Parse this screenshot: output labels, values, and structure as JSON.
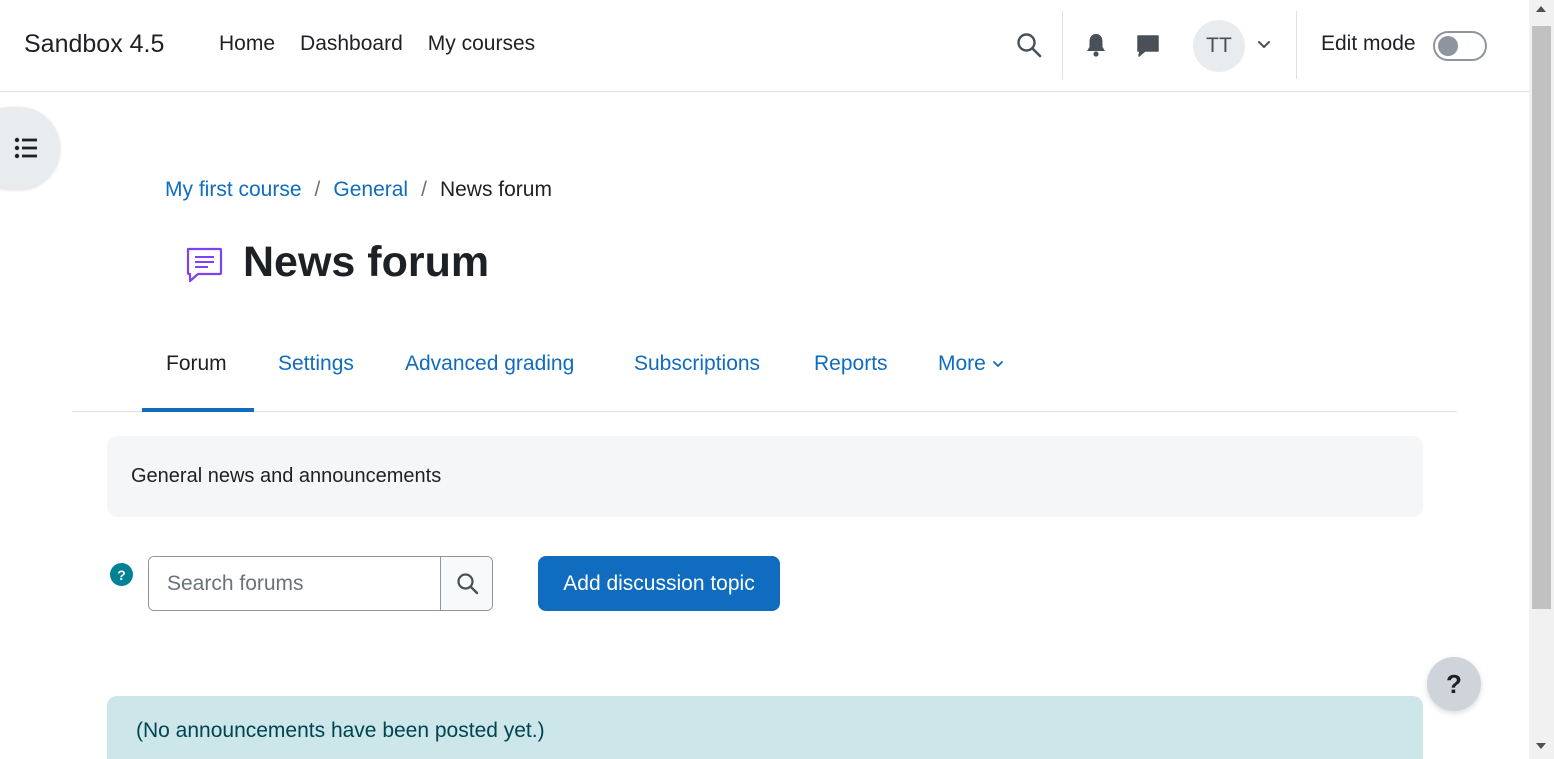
{
  "navbar": {
    "brand": "Sandbox 4.5",
    "links": [
      "Home",
      "Dashboard",
      "My courses"
    ],
    "search_icon": "search-icon",
    "notifications_icon": "bell-icon",
    "messages_icon": "chat-bubble-icon",
    "avatar_initials": "TT",
    "user_menu_icon": "chevron-down-icon",
    "edit_mode_label": "Edit mode",
    "edit_mode_on": false
  },
  "drawer": {
    "icon": "list-icon"
  },
  "breadcrumb": {
    "items": [
      "My first course",
      "General"
    ],
    "separator": "/",
    "current": "News forum"
  },
  "page": {
    "title": "News forum",
    "icon": "forum-icon"
  },
  "tabs": {
    "items": [
      "Forum",
      "Settings",
      "Advanced grading",
      "Subscriptions",
      "Reports",
      "More"
    ],
    "active": "Forum"
  },
  "intro": {
    "text": "General news and announcements"
  },
  "search": {
    "placeholder": "Search forums",
    "help_symbol": "?",
    "submit_icon": "search-icon"
  },
  "actions": {
    "add_discussion": "Add discussion topic"
  },
  "alert": {
    "text": "(No announcements have been posted yet.)"
  },
  "floating_help": {
    "symbol": "?"
  },
  "colors": {
    "accent": "#0f6cbf",
    "help_badge": "#008196",
    "alert_bg": "#cce6ea",
    "forum_icon": "#7b42f6"
  }
}
